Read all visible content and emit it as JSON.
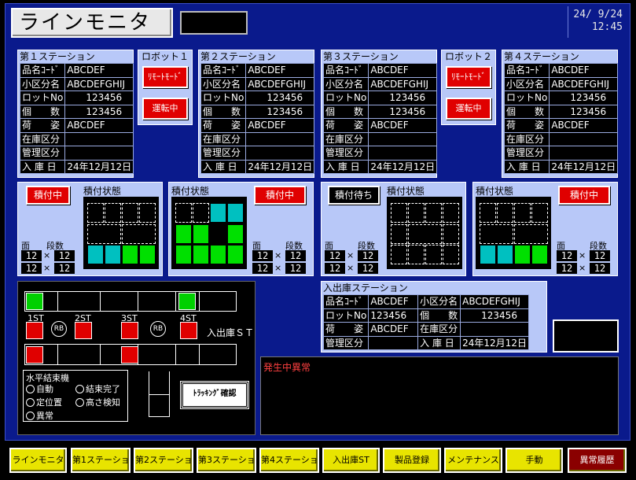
{
  "header": {
    "title": "ラインモニタ",
    "date": "24/ 9/24",
    "time": "12:45"
  },
  "stations": [
    {
      "title": "第１ステーション",
      "rows": [
        [
          "品名ｺｰﾄﾞ",
          "ABCDEF"
        ],
        [
          "小区分名",
          "ABCDEFGHIJ"
        ],
        [
          "ロットNo",
          "123456"
        ],
        [
          "個　　数",
          "123456"
        ],
        [
          "荷　　姿",
          "ABCDEF"
        ],
        [
          "在庫区分",
          ""
        ],
        [
          "管理区分",
          ""
        ],
        [
          "入 庫 日",
          "24年12月12日"
        ]
      ]
    },
    {
      "title": "第２ステーション",
      "rows": [
        [
          "品名ｺｰﾄﾞ",
          "ABCDEF"
        ],
        [
          "小区分名",
          "ABCDEFGHIJ"
        ],
        [
          "ロットNo",
          "123456"
        ],
        [
          "個　　数",
          "123456"
        ],
        [
          "荷　　姿",
          "ABCDEF"
        ],
        [
          "在庫区分",
          ""
        ],
        [
          "管理区分",
          ""
        ],
        [
          "入 庫 日",
          "24年12月12日"
        ]
      ]
    },
    {
      "title": "第３ステーション",
      "rows": [
        [
          "品名ｺｰﾄﾞ",
          "ABCDEF"
        ],
        [
          "小区分名",
          "ABCDEFGHIJ"
        ],
        [
          "ロットNo",
          "123456"
        ],
        [
          "個　　数",
          "123456"
        ],
        [
          "荷　　姿",
          "ABCDEF"
        ],
        [
          "在庫区分",
          ""
        ],
        [
          "管理区分",
          ""
        ],
        [
          "入 庫 日",
          "24年12月12日"
        ]
      ]
    },
    {
      "title": "第４ステーション",
      "rows": [
        [
          "品名ｺｰﾄﾞ",
          "ABCDEF"
        ],
        [
          "小区分名",
          "ABCDEFGHIJ"
        ],
        [
          "ロットNo",
          "123456"
        ],
        [
          "個　　数",
          "123456"
        ],
        [
          "荷　　姿",
          "ABCDEF"
        ],
        [
          "在庫区分",
          ""
        ],
        [
          "管理区分",
          ""
        ],
        [
          "入 庫 日",
          "24年12月12日"
        ]
      ]
    }
  ],
  "robots": [
    {
      "title": "ロボット１",
      "mode": "ﾘﾓｰﾄﾓｰﾄﾞ",
      "status": "運転中"
    },
    {
      "title": "ロボット２",
      "mode": "ﾘﾓｰﾄﾓｰﾄﾞ",
      "status": "運転中"
    }
  ],
  "stacking": [
    {
      "status": "積付中",
      "title": "積付状態",
      "faces_label": "面",
      "tiers_label": "段数",
      "faces": [
        "12",
        "12"
      ],
      "tiers": [
        "12",
        "12"
      ],
      "mult": "×"
    },
    {
      "status": "積付中",
      "title": "積付状態",
      "faces_label": "面",
      "tiers_label": "段数",
      "faces": [
        "12",
        "12"
      ],
      "tiers": [
        "12",
        "12"
      ],
      "mult": "×"
    },
    {
      "status": "積付待ち",
      "title": "積付状態",
      "faces_label": "面",
      "tiers_label": "段数",
      "faces": [
        "12",
        "12"
      ],
      "tiers": [
        "12",
        "12"
      ],
      "mult": "×"
    },
    {
      "status": "積付中",
      "title": "積付状態",
      "faces_label": "面",
      "tiers_label": "段数",
      "faces": [
        "12",
        "12"
      ],
      "tiers": [
        "12",
        "12"
      ],
      "mult": "×"
    }
  ],
  "io_station": {
    "title": "入出庫ステーション",
    "rows": [
      [
        "品名ｺｰﾄﾞ",
        "ABCDEF",
        "小区分名",
        "ABCDEFGHIJ"
      ],
      [
        "ロットNo",
        "123456",
        "個　　数",
        "123456"
      ],
      [
        "荷　　姿",
        "ABCDEF",
        "在庫区分",
        ""
      ],
      [
        "管理区分",
        "",
        "入 庫 日",
        "24年12月12日"
      ]
    ]
  },
  "layout": {
    "st1": "1ST",
    "st2": "2ST",
    "st3": "3ST",
    "st4": "4ST",
    "rb1": "RB",
    "rb2": "RB",
    "io": "入出庫ＳＴ",
    "legend_title": "水平結束機",
    "legend": [
      "自動",
      "結束完了",
      "定位置",
      "高さ検知",
      "異常"
    ],
    "tracking": "ﾄﾗｯｷﾝｸﾞ確認"
  },
  "alarm": {
    "title": "発生中異常"
  },
  "nav": [
    "ラインモニタ",
    "第1ステーション",
    "第2ステーション",
    "第3ステーション",
    "第4ステーション",
    "入出庫ST",
    "製品登録",
    "メンテナンス",
    "手動",
    "異常履歴"
  ],
  "colors": {
    "background": "#0a1a8c",
    "panel": "#b8c8f8",
    "red": "#e00000",
    "green": "#00e000",
    "cyan": "#00c0c0",
    "nav": "#e8e400",
    "nav_active": "#8a0000"
  }
}
